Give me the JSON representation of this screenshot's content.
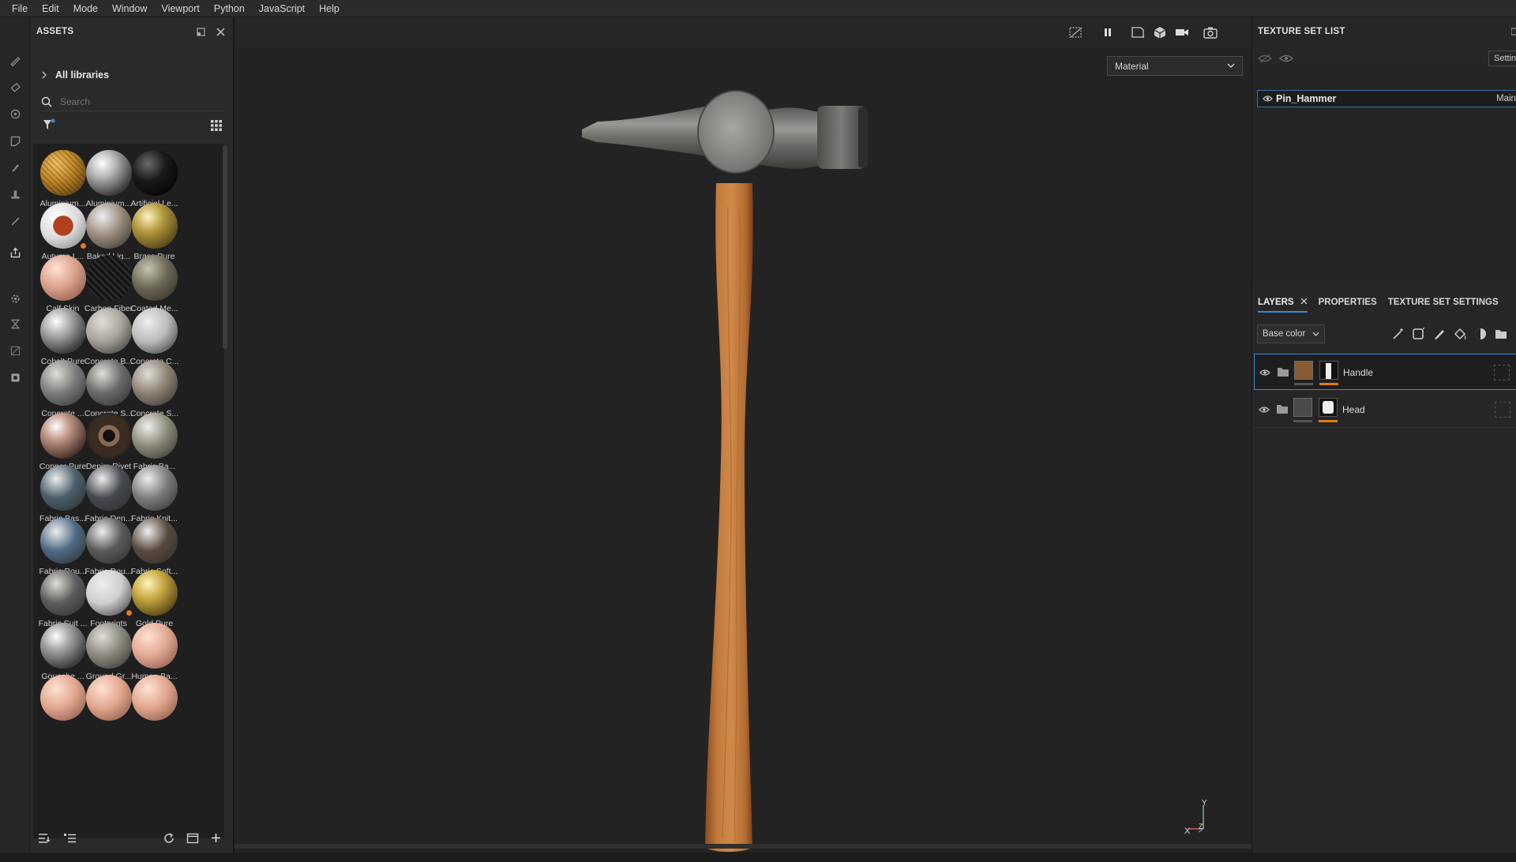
{
  "menu": [
    "File",
    "Edit",
    "Mode",
    "Window",
    "Viewport",
    "Python",
    "JavaScript",
    "Help"
  ],
  "assets": {
    "title": "ASSETS",
    "library": "All libraries",
    "search_placeholder": "Search",
    "items": [
      {
        "label": "Aluminium...",
        "color": "#c48a2a",
        "style": "gold-mesh"
      },
      {
        "label": "Aluminium...",
        "color": "#b8b8b8",
        "style": "chrome"
      },
      {
        "label": "Artificial Le...",
        "color": "#1a1a1a",
        "style": "dark"
      },
      {
        "label": "Autumn L...",
        "color": "#d9d9d9",
        "style": "leaf",
        "badge": true
      },
      {
        "label": "Baked Lig...",
        "color": "#9a8b7a",
        "style": "matte"
      },
      {
        "label": "Brass Pure",
        "color": "#b39a40",
        "style": "gold"
      },
      {
        "label": "Calf Skin",
        "color": "#d9a08a",
        "style": "skin"
      },
      {
        "label": "Carbon Fiber",
        "color": "#1c1c1c",
        "style": "carbon"
      },
      {
        "label": "Coated Me...",
        "color": "#6b6655",
        "style": "metal"
      },
      {
        "label": "Cobalt Pure",
        "color": "#b0b0b0",
        "style": "chrome"
      },
      {
        "label": "Concrete B...",
        "color": "#a8a49c",
        "style": "stone"
      },
      {
        "label": "Concrete C...",
        "color": "#bdbdbd",
        "style": "matte"
      },
      {
        "label": "Concrete ...",
        "color": "#7c7c7c",
        "style": "stone"
      },
      {
        "label": "Concrete S...",
        "color": "#6a6a6a",
        "style": "stone"
      },
      {
        "label": "Concrete S...",
        "color": "#8f8274",
        "style": "stone"
      },
      {
        "label": "Copper Pure",
        "color": "#c49a8a",
        "style": "copper"
      },
      {
        "label": "Denim Rivet",
        "color": "#3a2c22",
        "style": "rivet"
      },
      {
        "label": "Fabric Ba...",
        "color": "#8c8a78",
        "style": "matte"
      },
      {
        "label": "Fabric Bas...",
        "color": "#4b5e6a",
        "style": "matte"
      },
      {
        "label": "Fabric Den...",
        "color": "#464a4e",
        "style": "matte"
      },
      {
        "label": "Fabric Knit...",
        "color": "#7c7c7c",
        "style": "matte"
      },
      {
        "label": "Fabric Rou...",
        "color": "#4e6a85",
        "style": "matte"
      },
      {
        "label": "Fabric Rou...",
        "color": "#5a5a58",
        "style": "matte"
      },
      {
        "label": "Fabric Soft...",
        "color": "#5a4a40",
        "style": "matte"
      },
      {
        "label": "Fabric Suit ...",
        "color": "#5c5c5c",
        "style": "stone"
      },
      {
        "label": "Footprints",
        "color": "#cfcfcf",
        "style": "matte",
        "badge": true
      },
      {
        "label": "Gold Pure",
        "color": "#c9a942",
        "style": "gold"
      },
      {
        "label": "Gouache ...",
        "color": "#a8a8a8",
        "style": "chrome"
      },
      {
        "label": "Ground Gr...",
        "color": "#8a887c",
        "style": "stone"
      },
      {
        "label": "Human Ba...",
        "color": "#e0a892",
        "style": "skin"
      },
      {
        "label": "",
        "color": "#e2a68e",
        "style": "skin"
      },
      {
        "label": "",
        "color": "#e2a68e",
        "style": "skin"
      },
      {
        "label": "",
        "color": "#e2a68e",
        "style": "skin"
      }
    ]
  },
  "viewport": {
    "material_mode": "Material",
    "axis": {
      "x": "X",
      "y": "Y",
      "z": "Z"
    }
  },
  "texture_set_list": {
    "title": "TEXTURE SET LIST",
    "settings_label": "Settin",
    "item_name": "Pin_Hammer",
    "item_shader": "Main"
  },
  "layers_panel": {
    "tabs": [
      "LAYERS",
      "PROPERTIES",
      "TEXTURE SET SETTINGS"
    ],
    "channel": "Base color",
    "layers": [
      {
        "name": "Handle",
        "selected": true
      },
      {
        "name": "Head",
        "selected": false
      }
    ]
  },
  "colors": {
    "accent_blue": "#3a86d8",
    "accent_orange": "#e07b1b"
  }
}
